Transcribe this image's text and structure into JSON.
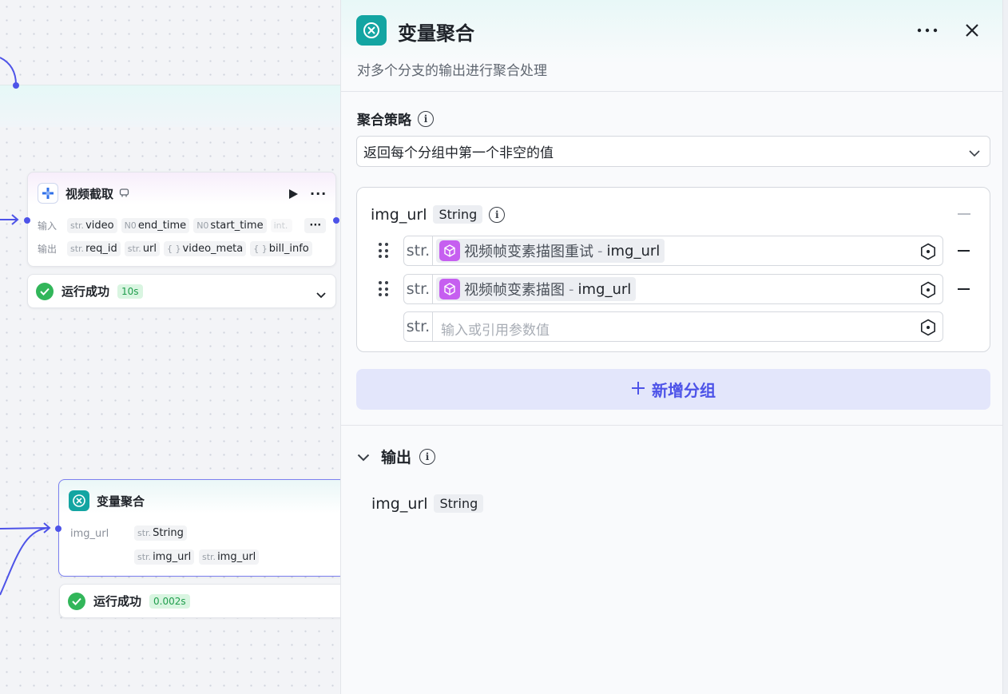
{
  "canvas": {
    "video_node": {
      "title": "视频截取",
      "input_label": "输入",
      "output_label": "输出",
      "inputs": [
        {
          "type": "str.",
          "name": "video"
        },
        {
          "type": "N0",
          "name": "end_time"
        },
        {
          "type": "N0",
          "name": "start_time"
        },
        {
          "type": "int.",
          "name": ""
        }
      ],
      "more_inputs": "···",
      "outputs": [
        {
          "type": "str.",
          "name": "req_id"
        },
        {
          "type": "str.",
          "name": "url"
        },
        {
          "type": "{ }",
          "name": "video_meta"
        },
        {
          "type": "{ }",
          "name": "bill_info"
        }
      ],
      "status": "运行成功",
      "duration": "10s"
    },
    "agg_node": {
      "title": "变量聚合",
      "var_label": "img_url",
      "type_tag": {
        "type": "str.",
        "name": "String"
      },
      "refs": [
        {
          "type": "str.",
          "name": "img_url"
        },
        {
          "type": "str.",
          "name": "img_url"
        }
      ],
      "status": "运行成功",
      "duration": "0.002s"
    }
  },
  "panel": {
    "title": "变量聚合",
    "description": "对多个分支的输出进行聚合处理",
    "more_icon": "more-horizontal-icon",
    "close_icon": "close-icon",
    "strategy_label": "聚合策略",
    "strategy_value": "返回每个分组中第一个非空的值",
    "group": {
      "name": "img_url",
      "type": "String",
      "rows": [
        {
          "prefix": "str.",
          "node": "视频帧变素描图重试",
          "sep": "-",
          "var": "img_url"
        },
        {
          "prefix": "str.",
          "node": "视频帧变素描图",
          "sep": "-",
          "var": "img_url"
        }
      ],
      "empty_row": {
        "prefix": "str.",
        "placeholder": "输入或引用参数值"
      }
    },
    "add_group_label": "新增分组",
    "output_label": "输出",
    "output_var": {
      "name": "img_url",
      "type": "String"
    }
  },
  "colors": {
    "accent": "#4d53e8",
    "teal": "#13a5a2",
    "success": "#32b65a",
    "ref_purple": "#c65ff0"
  }
}
